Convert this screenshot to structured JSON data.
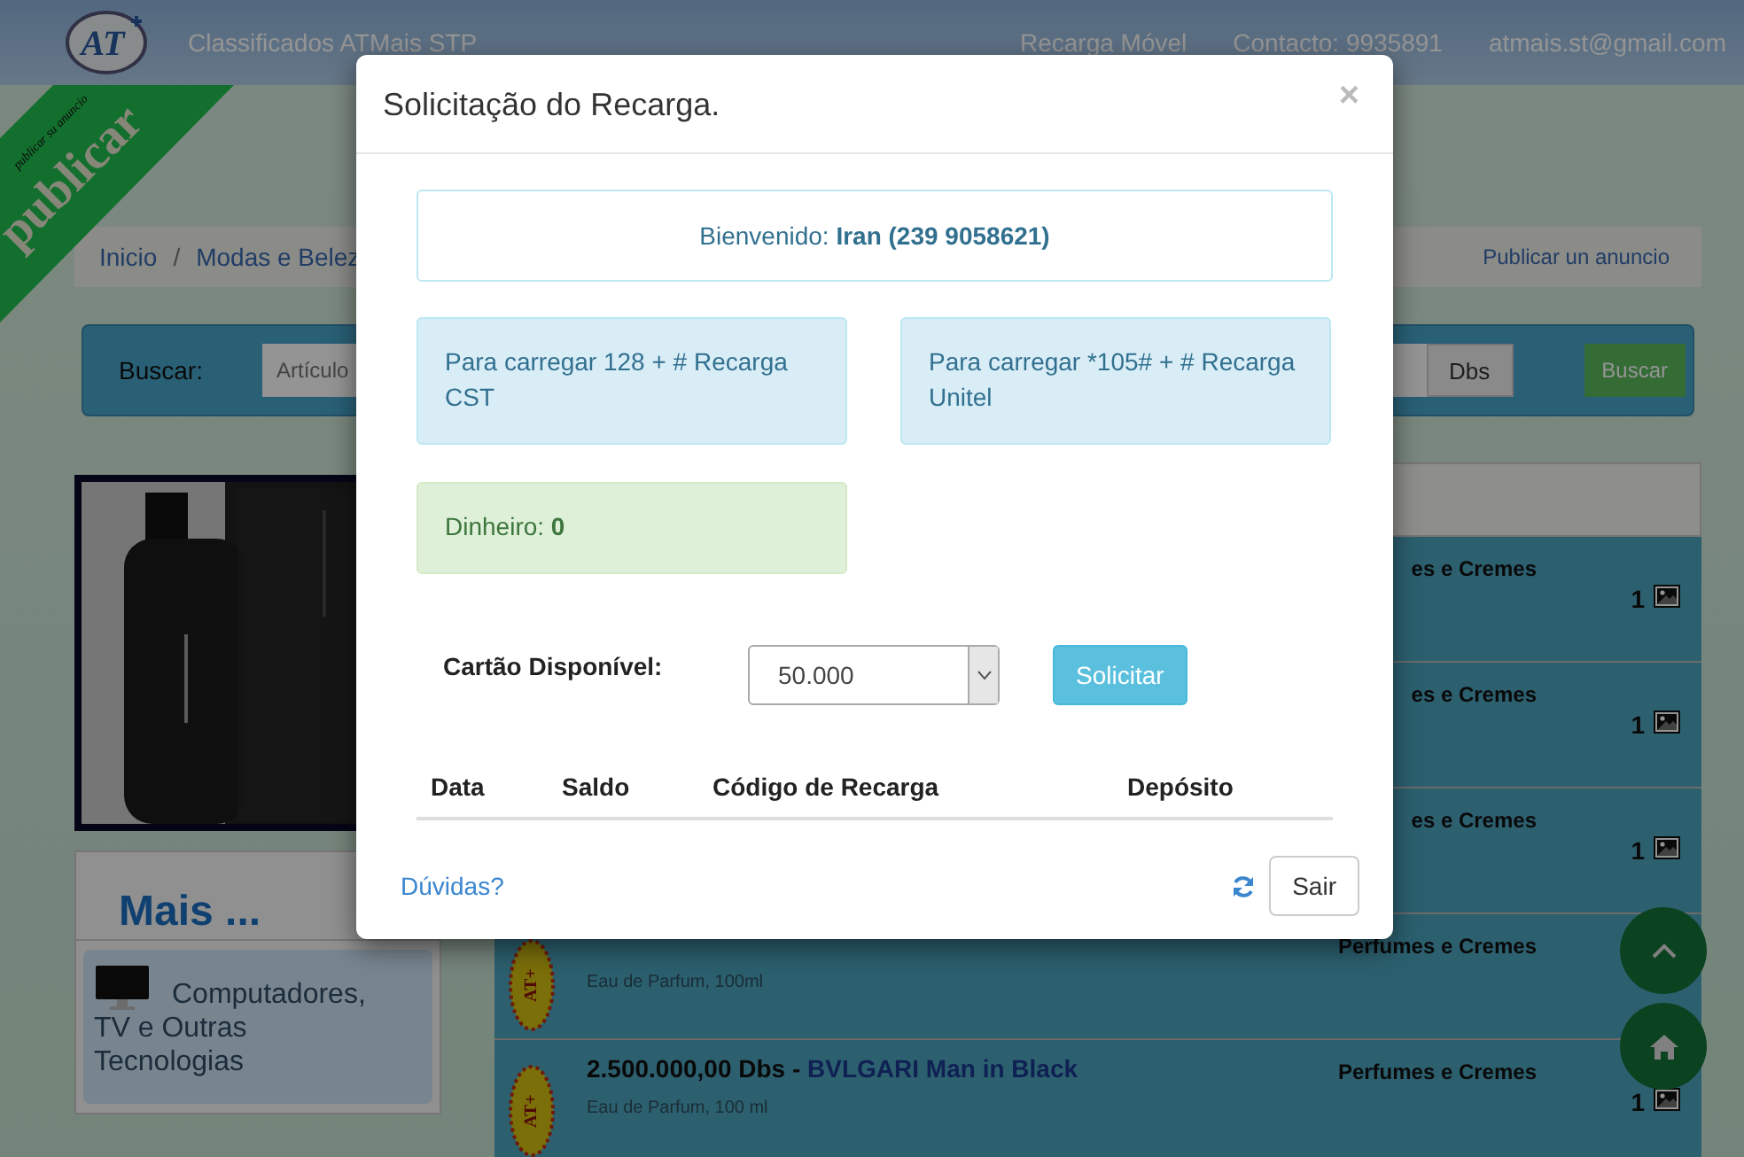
{
  "header": {
    "logo_text": "AT",
    "site_title": "Classificados ATMais STP",
    "links": [
      "Recarga Móvel",
      "Contacto: 9935891",
      "atmais.st@gmail.com"
    ]
  },
  "ribbon": {
    "title": "publicar",
    "subtitle": "publicar su anuncio"
  },
  "breadcrumb": {
    "separator": "/",
    "items": [
      "Inicio",
      "Modas e Belez"
    ],
    "action": "Publicar un anuncio"
  },
  "search": {
    "label": "Buscar:",
    "placeholder": "Artículo",
    "currency": "Dbs",
    "button": "Buscar"
  },
  "sidebar": {
    "heading": "Mais ...",
    "items": [
      {
        "label": "Computadores, TV e Outras Tecnologias"
      }
    ]
  },
  "listings": [
    {
      "category": "es e Cremes",
      "photos": "1"
    },
    {
      "category": "es e Cremes",
      "photos": "1"
    },
    {
      "category": "es e Cremes",
      "photos": "1"
    },
    {
      "badge": "AT+",
      "description": "Eau de Parfum, 100ml",
      "category": "Perfumes e Cremes"
    },
    {
      "badge": "AT+",
      "price": "2.500.000,00 Dbs",
      "separator": "-",
      "name": "BVLGARI Man in Black",
      "description": "Eau de Parfum, 100 ml",
      "category": "Perfumes e Cremes",
      "photos": "1"
    }
  ],
  "modal": {
    "title": "Solicitação do Recarga.",
    "close": "×",
    "welcome": {
      "label": "Bienvenido:",
      "user": "Iran (239 9058621)"
    },
    "info": [
      "Para carregar 128 + # Recarga CST",
      "Para carregar *105# + # Recarga Unitel"
    ],
    "balance": {
      "label": "Dinheiro:",
      "value": "0"
    },
    "card": {
      "label": "Cartão Disponível:",
      "value": "50.000",
      "button": "Solicitar"
    },
    "table": {
      "columns": [
        "Data",
        "Saldo",
        "Código de Recarga",
        "Depósito"
      ]
    },
    "help_link": "Dúvidas?",
    "exit_button": "Sair"
  }
}
